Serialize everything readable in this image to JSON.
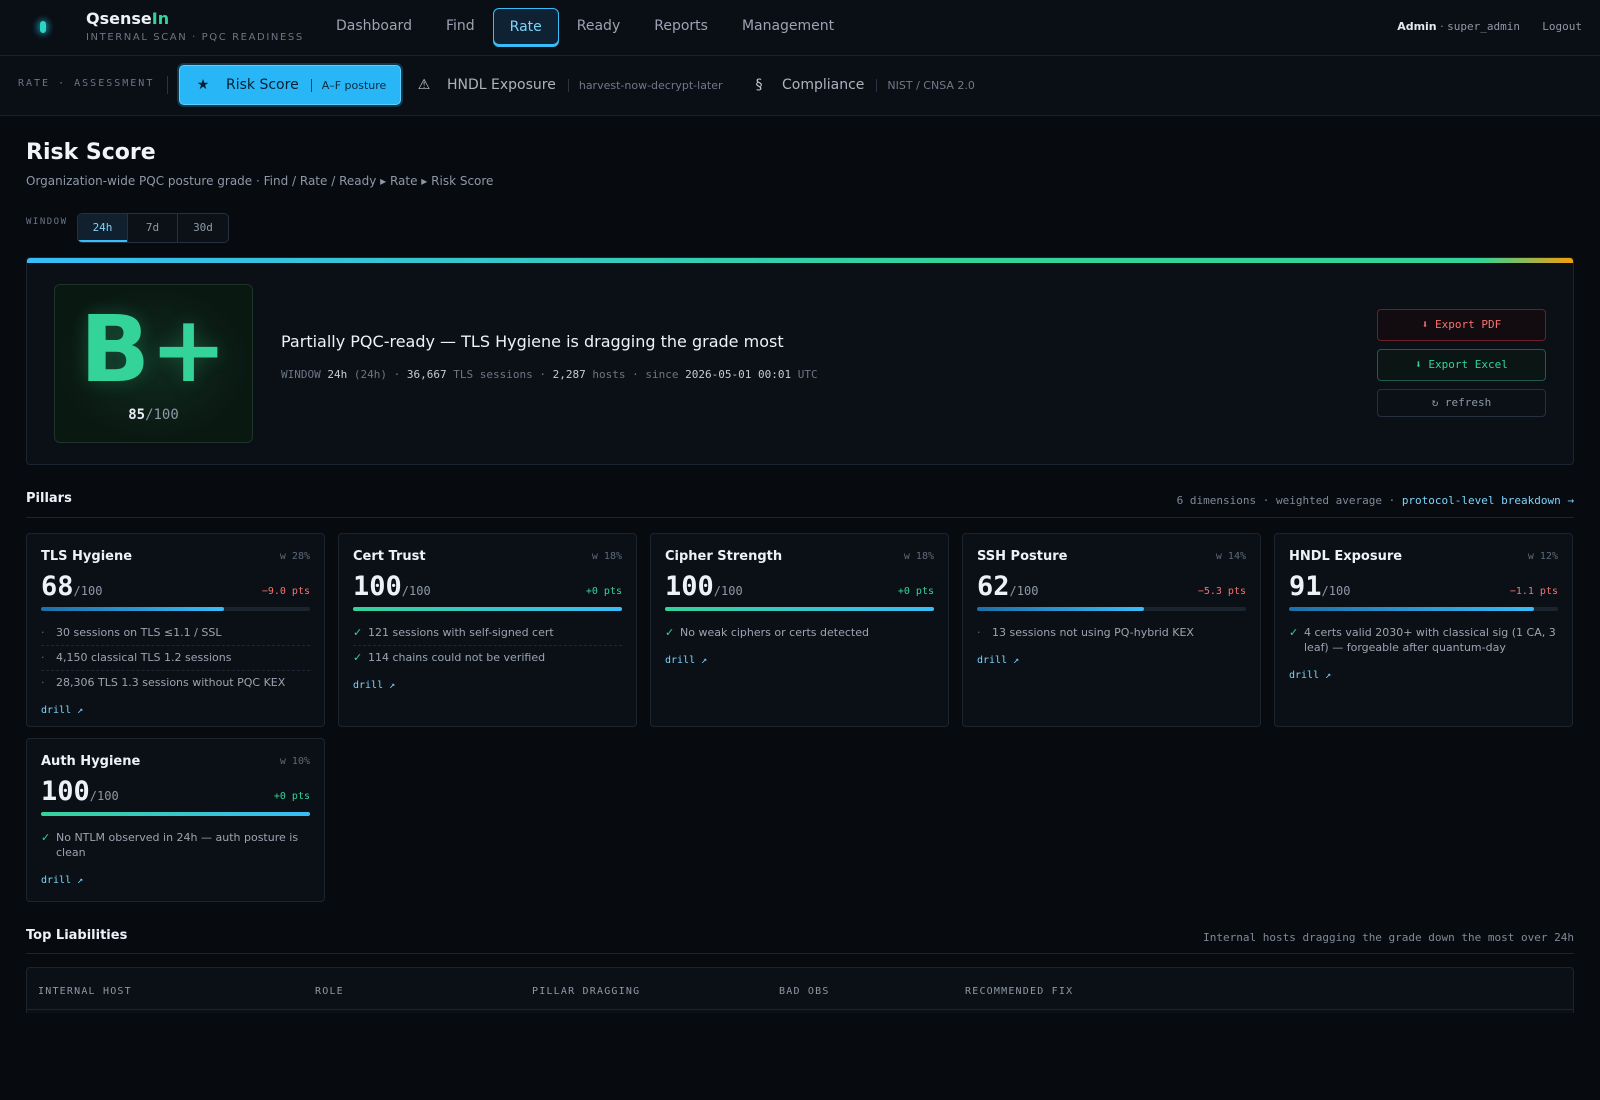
{
  "app": {
    "brand_main": "Qsense",
    "brand_accent": "In",
    "subtitle": "INTERNAL SCAN · PQC READINESS"
  },
  "nav": {
    "items": [
      "Dashboard",
      "Find",
      "Rate",
      "Ready",
      "Reports",
      "Management"
    ],
    "active": "Rate"
  },
  "user": {
    "role": "Admin",
    "separator": "·",
    "username": "super_admin",
    "logout": "Logout"
  },
  "subnav": {
    "label": "RATE · ASSESSMENT",
    "tabs": [
      {
        "icon": "★",
        "label": "Risk Score",
        "tag": "A–F posture",
        "active": true
      },
      {
        "icon": "⚠",
        "label": "HNDL Exposure",
        "tag": "harvest-now-decrypt-later",
        "active": false
      },
      {
        "icon": "§",
        "label": "Compliance",
        "tag": "NIST / CNSA 2.0",
        "active": false
      }
    ]
  },
  "page": {
    "title": "Risk Score",
    "subtitle": "Organization-wide PQC posture grade · Find / Rate / Ready ▸ Rate ▸ Risk Score"
  },
  "window": {
    "label": "WINDOW",
    "options": [
      "24h",
      "7d",
      "30d"
    ],
    "selected": "24h"
  },
  "hero": {
    "grade": "B+",
    "score": "85",
    "score_out_of": "/100",
    "headline": "Partially PQC-ready — TLS Hygiene is dragging the grade most",
    "meta": {
      "window_label": "WINDOW",
      "window_value": "24h",
      "window_paren": "(24h)",
      "sessions_value": "36,667",
      "sessions_label": "TLS sessions",
      "hosts_value": "2,287",
      "hosts_label": "hosts",
      "since_label": "since",
      "since_value": "2026-05-01 00:01",
      "tz": "UTC"
    },
    "buttons": {
      "export_pdf": "⬇ Export PDF",
      "export_excel": "⬇ Export Excel",
      "refresh": "↻ refresh"
    }
  },
  "pillars": {
    "title": "Pillars",
    "summary": "6 dimensions · weighted average ·",
    "link": "protocol-level breakdown →",
    "drill_label": "drill ↗",
    "cards": [
      {
        "name": "TLS Hygiene",
        "weight": "w 28%",
        "score": "68",
        "out_of": "/100",
        "delta": "−9.0 pts",
        "delta_sign": "neg",
        "level": 0.68,
        "items": [
          {
            "mark": "·",
            "ok": false,
            "text": "30 sessions on TLS ≤1.1 / SSL"
          },
          {
            "mark": "·",
            "ok": false,
            "text": "4,150 classical TLS 1.2 sessions"
          },
          {
            "mark": "·",
            "ok": false,
            "text": "28,306 TLS 1.3 sessions without PQC KEX"
          }
        ]
      },
      {
        "name": "Cert Trust",
        "weight": "w 18%",
        "score": "100",
        "out_of": "/100",
        "delta": "+0 pts",
        "delta_sign": "pos",
        "level": 1.0,
        "items": [
          {
            "mark": "✓",
            "ok": true,
            "text": "121 sessions with self-signed cert"
          },
          {
            "mark": "✓",
            "ok": true,
            "text": "114 chains could not be verified"
          }
        ]
      },
      {
        "name": "Cipher Strength",
        "weight": "w 18%",
        "score": "100",
        "out_of": "/100",
        "delta": "+0 pts",
        "delta_sign": "pos",
        "level": 1.0,
        "items": [
          {
            "mark": "✓",
            "ok": true,
            "text": "No weak ciphers or certs detected"
          }
        ]
      },
      {
        "name": "SSH Posture",
        "weight": "w 14%",
        "score": "62",
        "out_of": "/100",
        "delta": "−5.3 pts",
        "delta_sign": "neg",
        "level": 0.62,
        "items": [
          {
            "mark": "·",
            "ok": false,
            "text": "13 sessions not using PQ-hybrid KEX"
          }
        ]
      },
      {
        "name": "HNDL Exposure",
        "weight": "w 12%",
        "score": "91",
        "out_of": "/100",
        "delta": "−1.1 pts",
        "delta_sign": "neg",
        "level": 0.91,
        "items": [
          {
            "mark": "✓",
            "ok": true,
            "text": "4 certs valid 2030+ with classical sig (1 CA, 3 leaf) — forgeable after quantum-day"
          }
        ]
      },
      {
        "name": "Auth Hygiene",
        "weight": "w 10%",
        "score": "100",
        "out_of": "/100",
        "delta": "+0 pts",
        "delta_sign": "pos",
        "level": 1.0,
        "items": [
          {
            "mark": "✓",
            "ok": true,
            "text": "No NTLM observed in 24h — auth posture is clean"
          }
        ]
      }
    ]
  },
  "liabilities": {
    "title": "Top Liabilities",
    "subtitle": "Internal hosts dragging the grade down the most over 24h",
    "columns": [
      "INTERNAL HOST",
      "ROLE",
      "PILLAR DRAGGING",
      "BAD OBS",
      "RECOMMENDED FIX"
    ]
  },
  "colors": {
    "accent": "#38bdf8",
    "good": "#34d399",
    "bad": "#f87171"
  }
}
